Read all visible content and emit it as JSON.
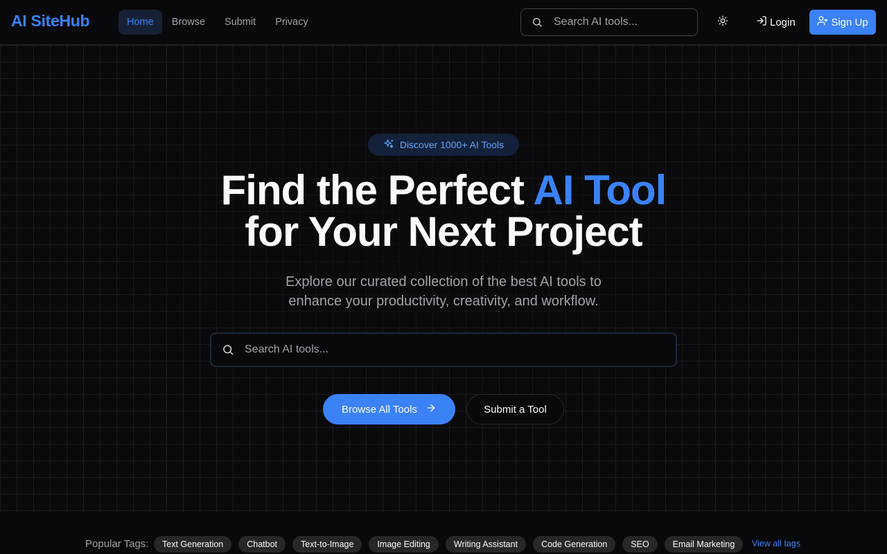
{
  "header": {
    "logo": "AI SiteHub",
    "nav": [
      {
        "label": "Home",
        "active": true
      },
      {
        "label": "Browse",
        "active": false
      },
      {
        "label": "Submit",
        "active": false
      },
      {
        "label": "Privacy",
        "active": false
      }
    ],
    "search_placeholder": "Search AI tools...",
    "theme_icon": "sun-icon",
    "login_label": "Login",
    "signup_label": "Sign Up"
  },
  "hero": {
    "badge": "Discover 1000+ AI Tools",
    "title_part1": "Find the Perfect",
    "title_accent": "AI Tool",
    "title_line2": "for Your Next Project",
    "subtitle": "Explore our curated collection of the best AI tools to enhance your productivity, creativity, and workflow.",
    "search_placeholder": "Search AI tools...",
    "browse_label": "Browse All Tools",
    "submit_label": "Submit a Tool"
  },
  "tags": {
    "label": "Popular Tags:",
    "items": [
      "Text Generation",
      "Chatbot",
      "Text-to-Image",
      "Image Editing",
      "Writing Assistant",
      "Code Generation",
      "SEO",
      "Email Marketing"
    ],
    "view_all": "View all tags"
  },
  "colors": {
    "accent": "#3b82f6",
    "background": "#09090b",
    "muted_text": "#a1a1aa"
  }
}
